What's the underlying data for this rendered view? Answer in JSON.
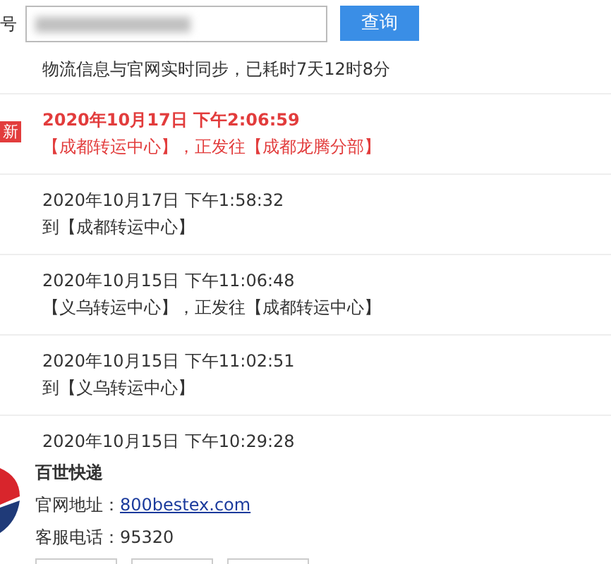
{
  "search": {
    "label": "号",
    "button": "查询"
  },
  "sync_note": "物流信息与官网实时同步，已耗时7天12时8分",
  "events": [
    {
      "badge": "新",
      "time": "2020年10月17日 下午2:06:59",
      "status": "【成都转运中心】，正发往【成都龙腾分部】",
      "latest": true
    },
    {
      "time": "2020年10月17日 下午1:58:32",
      "status": "到【成都转运中心】",
      "latest": false
    },
    {
      "time": "2020年10月15日 下午11:06:48",
      "status": "【义乌转运中心】，正发往【成都转运中心】",
      "latest": false
    },
    {
      "time": "2020年10月15日 下午11:02:51",
      "status": "到【义乌转运中心】",
      "latest": false
    },
    {
      "time": "2020年10月15日 下午10:29:28",
      "latest": false
    }
  ],
  "courier": {
    "name": "百世快递",
    "site_label": "官网地址：",
    "site": "800bestex.com",
    "phone_label": "客服电话：",
    "phone": "95320"
  }
}
